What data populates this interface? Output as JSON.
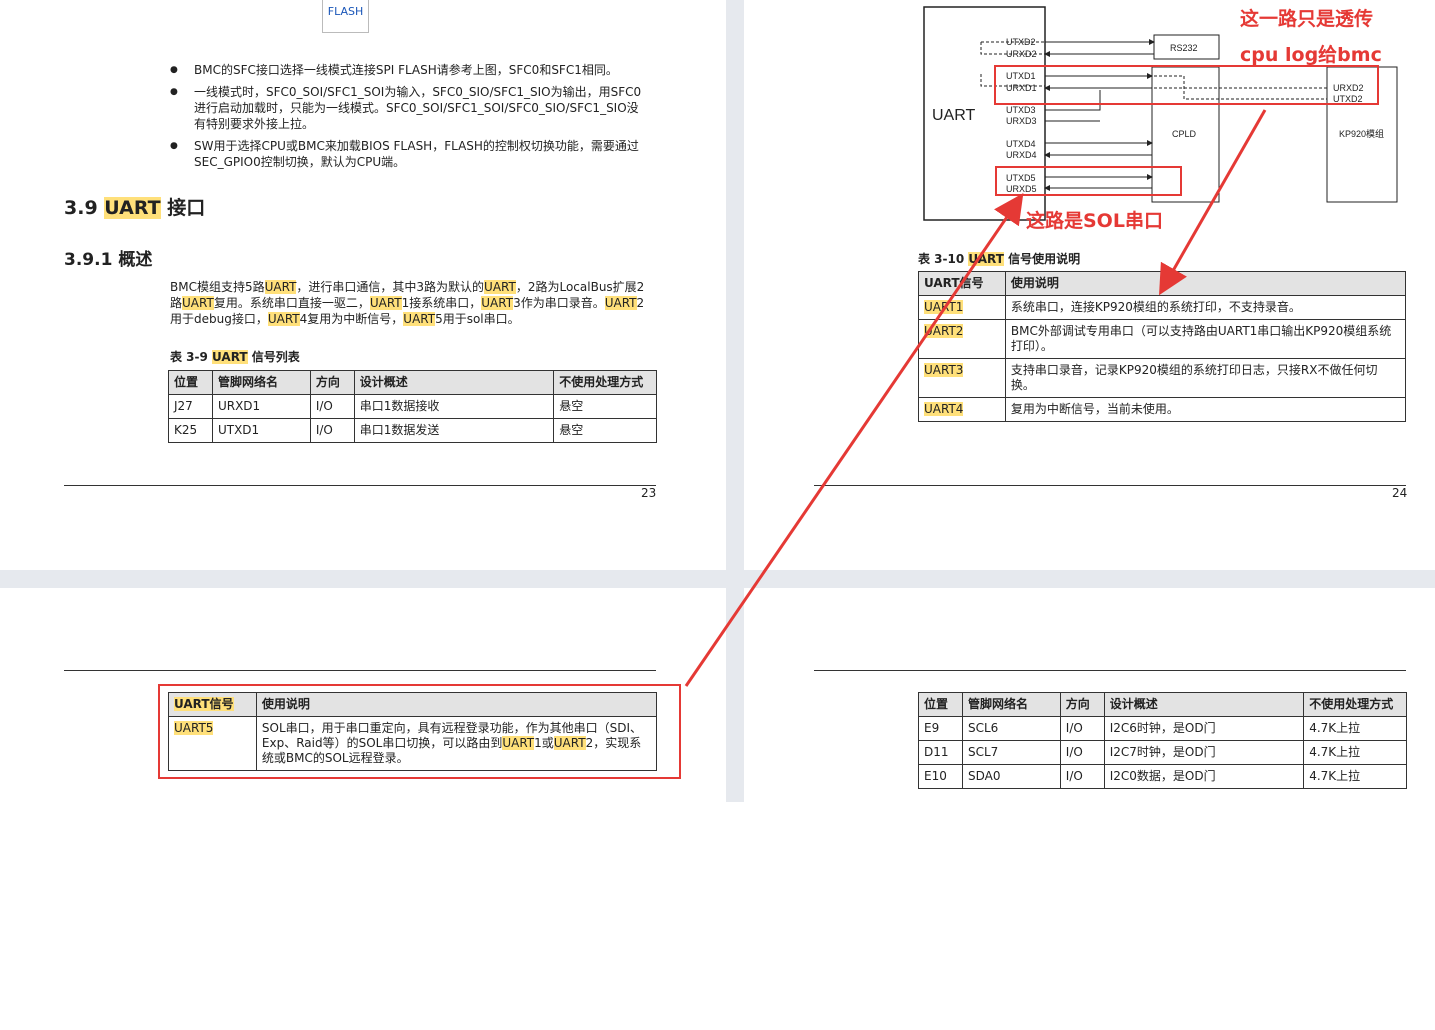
{
  "page23": {
    "flash_label": "FLASH",
    "bullets": [
      "BMC的SFC接口选择一线模式连接SPI FLASH请参考上图，SFC0和SFC1相同。",
      "一线模式时，SFC0_SOI/SFC1_SOI为输入，SFC0_SIO/SFC1_SIO为输出，用SFC0进行启动加载时，只能为一线模式。SFC0_SOI/SFC1_SOI/SFC0_SIO/SFC1_SIO没有特别要求外接上拉。",
      "SW用于选择CPU或BMC来加载BIOS FLASH，FLASH的控制权切换功能，需要通过SEC_GPIO0控制切换，默认为CPU端。"
    ],
    "section_num": "3.9 ",
    "section_hl": "UART",
    "section_rest": " 接口",
    "subsection": "3.9.1 概述",
    "para": [
      {
        "t": "BMC模组支持5路"
      },
      {
        "t": "UART",
        "hl": true
      },
      {
        "t": "，进行串口通信，其中3路为默认的"
      },
      {
        "t": "UART",
        "hl": true
      },
      {
        "t": "，2路为LocalBus扩展2路"
      },
      {
        "t": "UART",
        "hl": true
      },
      {
        "t": "复用。系统串口直接一驱二，"
      },
      {
        "t": "UART",
        "hl": true
      },
      {
        "t": "1接系统串口，"
      },
      {
        "t": "UART",
        "hl": true
      },
      {
        "t": "3作为串口录音。"
      },
      {
        "t": "UART",
        "hl": true
      },
      {
        "t": "2用于debug接口，"
      },
      {
        "t": "UART",
        "hl": true
      },
      {
        "t": "4复用为中断信号，"
      },
      {
        "t": "UART",
        "hl": true
      },
      {
        "t": "5用于sol串口。"
      }
    ],
    "table_caption_prefix": "表 3-9 ",
    "table_caption_hl": "UART",
    "table_caption_rest": " 信号列表",
    "table_headers": [
      "位置",
      "管脚网络名",
      "方向",
      "设计概述",
      "不使用处理方式"
    ],
    "table_rows": [
      [
        "J27",
        "URXD1",
        "I/O",
        "串口1数据接收",
        "悬空"
      ],
      [
        "K25",
        "UTXD1",
        "I/O",
        "串口1数据发送",
        "悬空"
      ]
    ],
    "page_number": "23"
  },
  "page24": {
    "diagram": {
      "uart_label": "UART",
      "rs232_label": "RS232",
      "cpld_label": "CPLD",
      "kp920_label": "KP920模组",
      "left_signals": [
        "UTXD2",
        "URXD2",
        "UTXD1",
        "URXD1",
        "UTXD3",
        "URXD3",
        "UTXD4",
        "URXD4",
        "UTXD5",
        "URXD5"
      ],
      "right_signals": [
        "URXD2",
        "UTXD2"
      ]
    },
    "annotation_top_line1": "这一路只是透传",
    "annotation_top_line2": "cpu log给bmc",
    "annotation_sol": "这路是SOL串口",
    "table_caption_prefix": "表 3-10 ",
    "table_caption_hl": "UART",
    "table_caption_rest": " 信号使用说明",
    "table_headers": [
      "UART信号",
      "使用说明"
    ],
    "table_rows": [
      [
        "UART1",
        "系统串口，连接KP920模组的系统打印，不支持录音。"
      ],
      [
        "UART2",
        "BMC外部调试专用串口（可以支持路由UART1串口输出KP920模组系统打印）。"
      ],
      [
        "UART3",
        "支持串口录音，记录KP920模组的系统打印日志，只接RX不做任何切换。"
      ],
      [
        "UART4",
        "复用为中断信号，当前未使用。"
      ]
    ],
    "page_number": "24"
  },
  "page25": {
    "table_headers": [
      "UART信号",
      "使用说明"
    ],
    "row_signal": "UART5",
    "row_desc": [
      {
        "t": "SOL串口，用于串口重定向，具有远程登录功能，作为其他串口（SDI、Exp、Raid等）的SOL串口切换，可以路由到"
      },
      {
        "t": "UART",
        "hl": true
      },
      {
        "t": "1或"
      },
      {
        "t": "UART",
        "hl": true
      },
      {
        "t": "2，实现系统或BMC的SOL远程登录。"
      }
    ]
  },
  "page26": {
    "table_headers": [
      "位置",
      "管脚网络名",
      "方向",
      "设计概述",
      "不使用处理方式"
    ],
    "table_rows": [
      [
        "E9",
        "SCL6",
        "I/O",
        "I2C6时钟，是OD门",
        "4.7K上拉"
      ],
      [
        "D11",
        "SCL7",
        "I/O",
        "I2C7时钟，是OD门",
        "4.7K上拉"
      ],
      [
        "E10",
        "SDA0",
        "I/O",
        "I2C0数据，是OD门",
        "4.7K上拉"
      ]
    ]
  },
  "colors": {
    "annotation_red": "#e53935",
    "highlight": "#ffe07a"
  }
}
